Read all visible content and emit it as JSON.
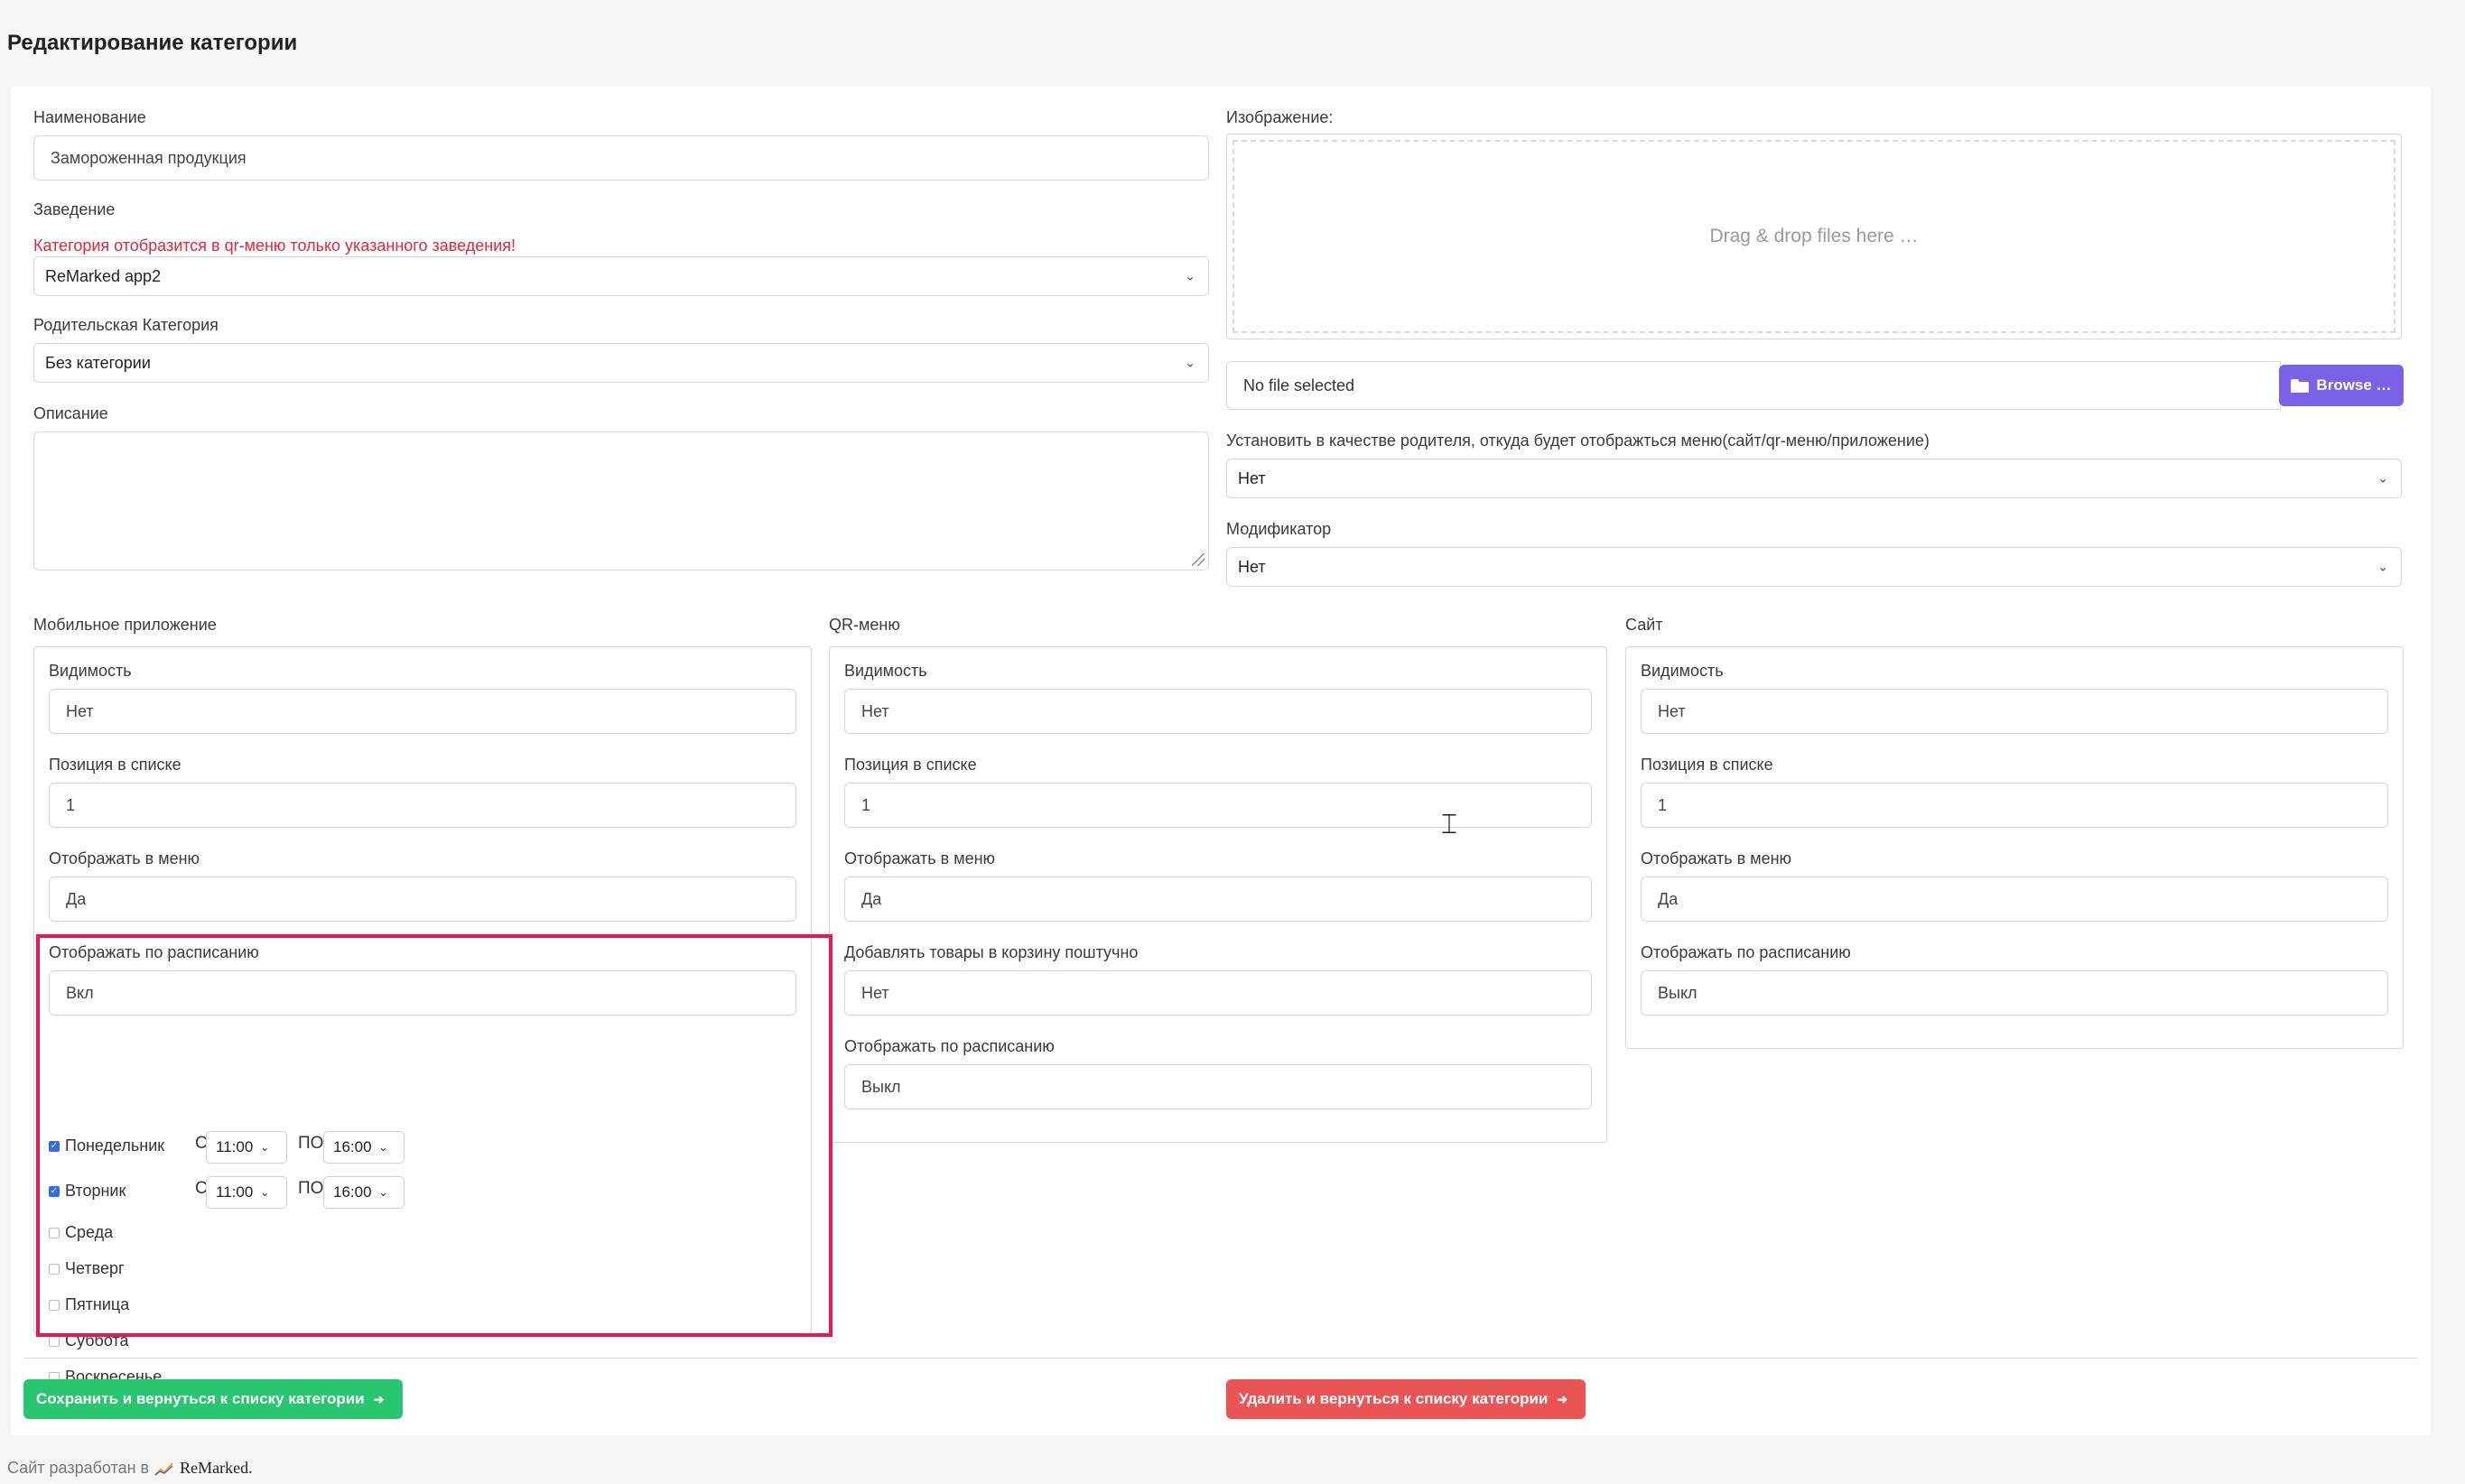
{
  "page_title": "Редактирование категории",
  "form": {
    "name_label": "Наименование",
    "name_value": "Замороженная продукция",
    "venue_label": "Заведение",
    "venue_warning": "Категория отобразится в qr-меню только указанного заведения!",
    "venue_value": "ReMarked app2",
    "parent_label": "Родительская Категория",
    "parent_value": "Без категории",
    "description_label": "Описание",
    "description_value": "",
    "image_label": "Изображение:",
    "dropzone_text": "Drag & drop files here …",
    "file_value": "No file selected",
    "browse_label": "Browse …",
    "set_parent_label": "Установить в качестве родителя, откуда будет отображться меню(сайт/qr-меню/приложение)",
    "set_parent_value": "Нет",
    "modifier_label": "Модификатор",
    "modifier_value": "Нет"
  },
  "mobile": {
    "title": "Мобильное приложение",
    "visibility_label": "Видимость",
    "visibility_value": "Нет",
    "position_label": "Позиция в списке",
    "position_value": "1",
    "show_menu_label": "Отображать в меню",
    "show_menu_value": "Да",
    "schedule_label": "Отображать по расписанию",
    "schedule_value": "Вкл",
    "days": [
      {
        "name": "Понедельник",
        "checked": true,
        "from_label": "С",
        "from": "11:00",
        "to_label": "ПО",
        "to": "16:00"
      },
      {
        "name": "Вторник",
        "checked": true,
        "from_label": "С",
        "from": "11:00",
        "to_label": "ПО",
        "to": "16:00"
      },
      {
        "name": "Среда",
        "checked": false
      },
      {
        "name": "Четверг",
        "checked": false
      },
      {
        "name": "Пятница",
        "checked": false
      },
      {
        "name": "Суббота",
        "checked": false
      },
      {
        "name": "Воскресенье",
        "checked": false
      }
    ]
  },
  "qr": {
    "title": "QR-меню",
    "visibility_label": "Видимость",
    "visibility_value": "Нет",
    "position_label": "Позиция в списке",
    "position_value": "1",
    "show_menu_label": "Отображать в меню",
    "show_menu_value": "Да",
    "cart_label": "Добавлять товары в корзину поштучно",
    "cart_value": "Нет",
    "schedule_label": "Отображать по расписанию",
    "schedule_value": "Выкл"
  },
  "site": {
    "title": "Сайт",
    "visibility_label": "Видимость",
    "visibility_value": "Нет",
    "position_label": "Позиция в списке",
    "position_value": "1",
    "show_menu_label": "Отображать в меню",
    "show_menu_value": "Да",
    "schedule_label": "Отображать по расписанию",
    "schedule_value": "Выкл"
  },
  "actions": {
    "save_label": "Сохранить и вернуться к списку категории",
    "delete_label": "Удалить и вернуться к списку категории"
  },
  "footer": {
    "text": "Сайт разработан в",
    "brand": "ReMarked."
  },
  "colors": {
    "accent_purple": "#7b61e8",
    "save_green": "#28c76f",
    "delete_red": "#ea5455",
    "warning_red": "#e2283c",
    "highlight_pink": "#e8194f"
  },
  "icons": [
    "chevron-down-icon",
    "folder-open-icon",
    "arrow-right-icon",
    "checkbox-icon",
    "chart-logo-icon",
    "text-cursor-icon"
  ]
}
